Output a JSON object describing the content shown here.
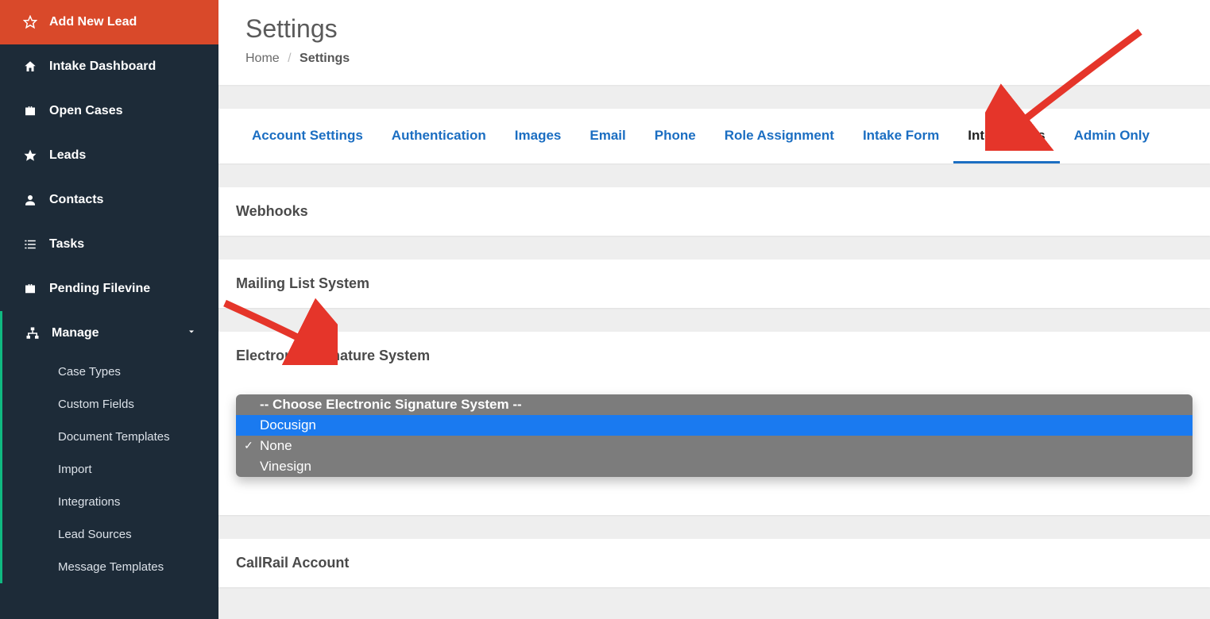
{
  "sidebar": {
    "primary": {
      "label": "Add New Lead"
    },
    "items": [
      {
        "label": "Intake Dashboard",
        "icon": "home"
      },
      {
        "label": "Open Cases",
        "icon": "briefcase"
      },
      {
        "label": "Leads",
        "icon": "star"
      },
      {
        "label": "Contacts",
        "icon": "user"
      },
      {
        "label": "Tasks",
        "icon": "list"
      },
      {
        "label": "Pending Filevine",
        "icon": "briefcase"
      }
    ],
    "manage": {
      "label": "Manage",
      "sub": [
        "Case Types",
        "Custom Fields",
        "Document Templates",
        "Import",
        "Integrations",
        "Lead Sources",
        "Message Templates"
      ]
    }
  },
  "page": {
    "title": "Settings",
    "breadcrumb": {
      "home": "Home",
      "current": "Settings"
    }
  },
  "tabs": [
    "Account Settings",
    "Authentication",
    "Images",
    "Email",
    "Phone",
    "Role Assignment",
    "Intake Form",
    "Integrations",
    "Admin Only"
  ],
  "active_tab_index": 7,
  "panels": {
    "webhooks": "Webhooks",
    "mailing": "Mailing List System",
    "esig": "Electronic Signature System",
    "callrail": "CallRail Account"
  },
  "esig_dropdown": {
    "placeholder": "-- Choose Electronic Signature System --",
    "options": [
      "Docusign",
      "None",
      "Vinesign"
    ],
    "highlighted_index": 0,
    "selected_index": 1
  }
}
